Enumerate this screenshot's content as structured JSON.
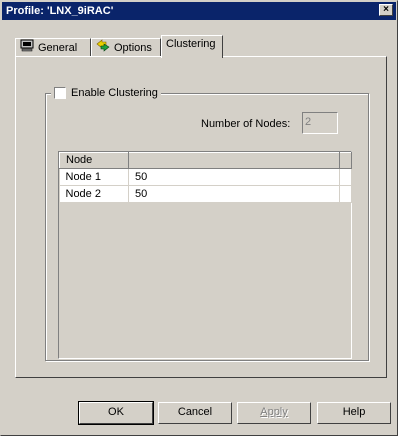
{
  "window": {
    "title": "Profile: 'LNX_9iRAC'",
    "close_glyph": "×"
  },
  "tabs": [
    {
      "label": "General",
      "icon": "computer-icon"
    },
    {
      "label": "Options",
      "icon": "options-arrows-icon"
    },
    {
      "label": "Clustering",
      "icon": "",
      "active": true
    }
  ],
  "clustering": {
    "enable_label": "Enable Clustering",
    "enable_checked": false,
    "nodes_label": "Number of Nodes:",
    "nodes_value": "2"
  },
  "grid": {
    "columns": [
      "Node",
      ""
    ],
    "rows": [
      [
        "Node 1",
        "50"
      ],
      [
        "Node 2",
        "50"
      ]
    ]
  },
  "buttons": {
    "ok": "OK",
    "cancel": "Cancel",
    "apply": "Apply",
    "help": "Help"
  },
  "colors": {
    "titlebar": "#0a246a",
    "face": "#d4d0c8"
  }
}
